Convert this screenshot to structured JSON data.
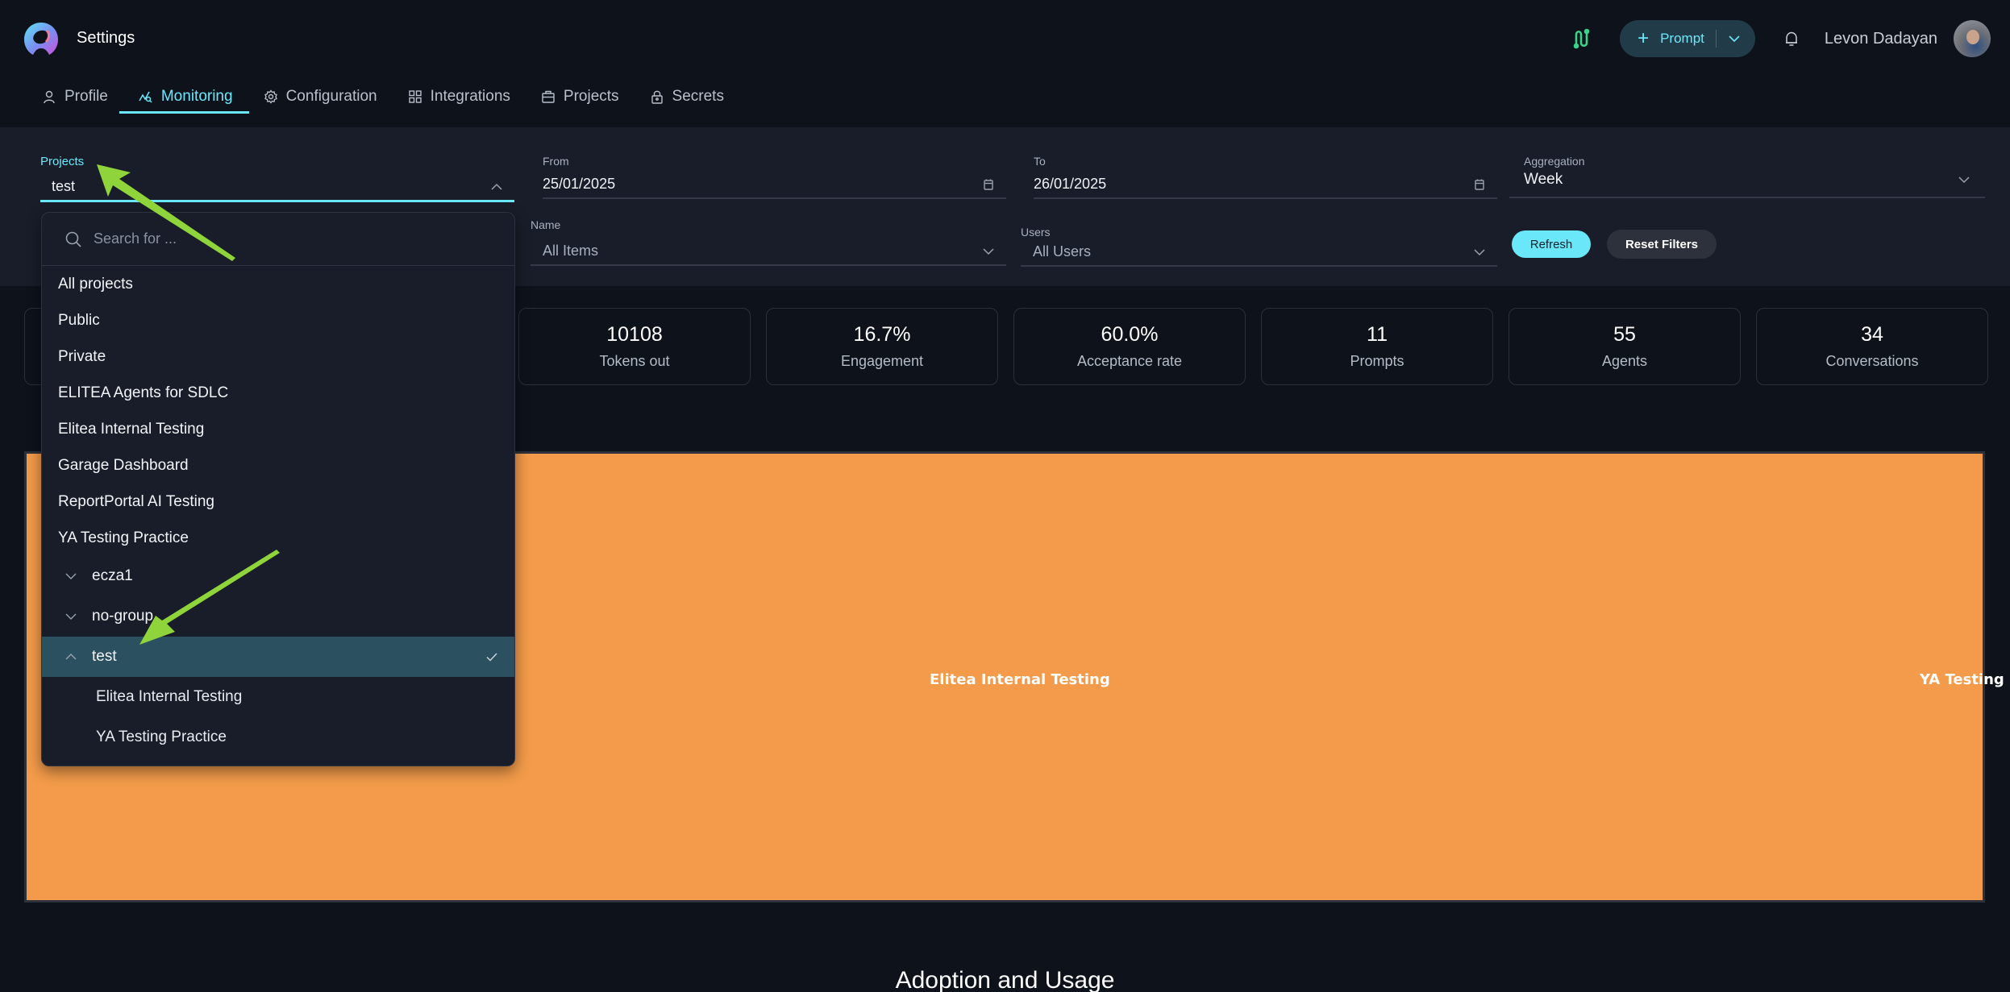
{
  "header": {
    "app_title": "Settings",
    "tabs": [
      {
        "label": "Profile",
        "icon": "user-icon",
        "active": false
      },
      {
        "label": "Monitoring",
        "icon": "monitoring-icon",
        "active": true
      },
      {
        "label": "Configuration",
        "icon": "gear-icon",
        "active": false
      },
      {
        "label": "Integrations",
        "icon": "grid-icon",
        "active": false
      },
      {
        "label": "Projects",
        "icon": "briefcase-icon",
        "active": false
      },
      {
        "label": "Secrets",
        "icon": "lock-icon",
        "active": false
      }
    ],
    "prompt_button": "Prompt",
    "user_name": "Levon Dadayan"
  },
  "filters": {
    "projects": {
      "label": "Projects",
      "value": "test"
    },
    "from": {
      "label": "From",
      "value": "25/01/2025"
    },
    "to": {
      "label": "To",
      "value": "26/01/2025"
    },
    "aggregation": {
      "label": "Aggregation",
      "value": "Week"
    },
    "name": {
      "label": "Name",
      "value": "All Items"
    },
    "users": {
      "label": "Users",
      "value": "All Users"
    },
    "refresh_label": "Refresh",
    "reset_label": "Reset Filters"
  },
  "dropdown": {
    "search_placeholder": "Search for ...",
    "items": [
      "All projects",
      "Public",
      "Private",
      "ELITEA Agents for SDLC",
      "Elitea Internal Testing",
      "Garage Dashboard",
      "ReportPortal AI Testing",
      "YA Testing Practice"
    ],
    "groups": [
      {
        "label": "ecza1",
        "expanded": false,
        "selected": false
      },
      {
        "label": "no-group",
        "expanded": false,
        "selected": false
      },
      {
        "label": "test",
        "expanded": true,
        "selected": true
      }
    ],
    "sub_items": [
      "Elitea Internal Testing",
      "YA Testing Practice"
    ]
  },
  "stats": [
    {
      "value": "10108",
      "caption": "Tokens out"
    },
    {
      "value": "16.7%",
      "caption": "Engagement"
    },
    {
      "value": "60.0%",
      "caption": "Acceptance rate"
    },
    {
      "value": "11",
      "caption": "Prompts"
    },
    {
      "value": "55",
      "caption": "Agents"
    },
    {
      "value": "34",
      "caption": "Conversations"
    }
  ],
  "treemap": {
    "color": "#f39b4a",
    "labels": [
      "Elitea Internal Testing",
      "YA Testing"
    ]
  },
  "section_title": "Adoption and Usage",
  "colors": {
    "accent": "#6ae8fa",
    "selected_row": "#2b5060",
    "annotation_arrow": "#8fd43a"
  }
}
